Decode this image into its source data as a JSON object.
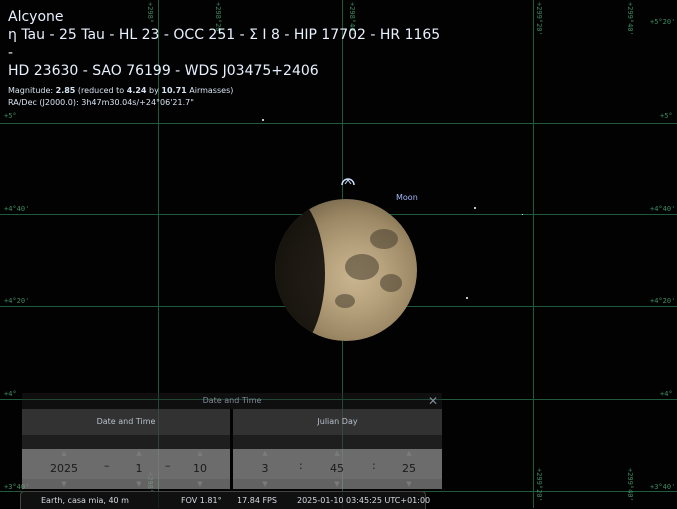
{
  "object_info": {
    "name": "Alcyone",
    "designations_line1": "η Tau - 25 Tau - HL 23 - OCC 251 - Σ I 8 - HIP 17702 - HR 1165 -",
    "designations_line2": "HD 23630 - SAO 76199 - WDS J03475+2406",
    "magnitude_label": "Magnitude:",
    "magnitude_value": "2.85",
    "reduced_to_text": "(reduced to",
    "reduced_value": "4.24",
    "by_text": "by",
    "airmasses_value": "10.71",
    "airmasses_text": "Airmasses)",
    "radec_label": "RA/Dec (J2000.0):",
    "radec_value": "3h47m30.04s/+24°06'21.7\""
  },
  "grid_labels": {
    "dec": [
      "+5°20'",
      "+5°",
      "+4°40'",
      "+4°20'",
      "+4°",
      "+3°40'"
    ],
    "ra_top": [
      "+297°40'",
      "+298°",
      "+298°20'",
      "+298°40'",
      "+299°",
      "+299°20'",
      "+299°40'"
    ]
  },
  "moon_label": "Moon",
  "icons": {
    "target": "selection-marker-icon",
    "close": "close-icon",
    "spin_up": "spin-up-icon",
    "spin_down": "spin-down-icon"
  },
  "dialog": {
    "title": "Date and Time",
    "date_time_header": "Date and Time",
    "julian_header": "Julian Day",
    "year": "2025",
    "month": "1",
    "day": "10",
    "hour": "3",
    "minute": "45",
    "second": "25",
    "date_sep": "–",
    "time_sep": ":"
  },
  "status_bar": {
    "location": "Earth, casa mia, 40 m",
    "fov": "FOV 1.81°",
    "fps": "17.84 FPS",
    "datetime": "2025-01-10 03:45:25 UTC+01:00"
  }
}
